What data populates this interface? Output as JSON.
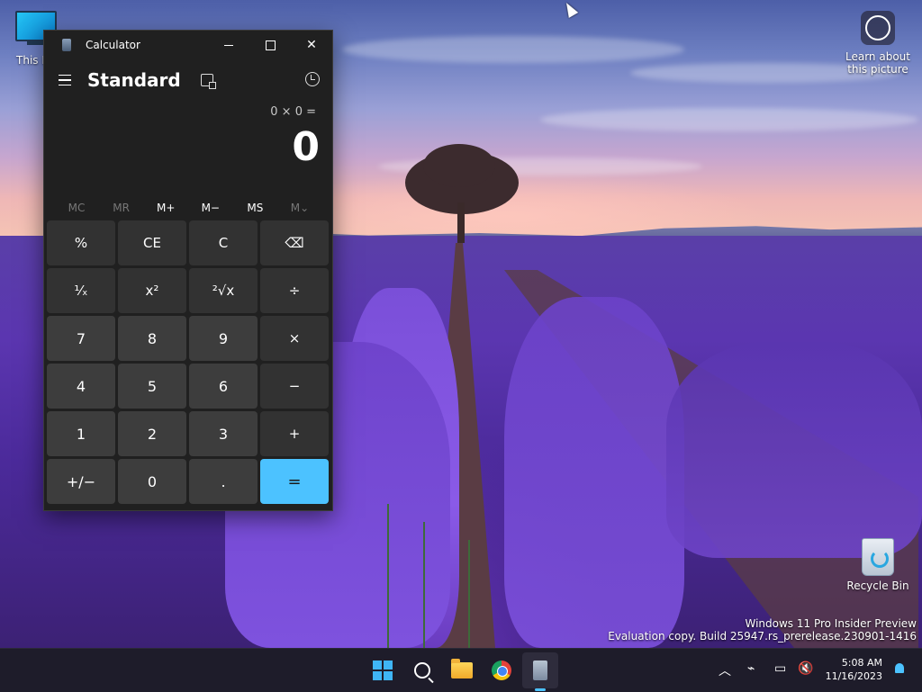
{
  "desktop": {
    "icons": [
      {
        "label": "This PC"
      },
      {
        "label": "Learn about this picture"
      },
      {
        "label": "Recycle Bin"
      }
    ],
    "watermark": {
      "line1": "Windows 11 Pro Insider Preview",
      "line2": "Evaluation copy. Build 25947.rs_prerelease.230901-1416"
    }
  },
  "calculator": {
    "window_title": "Calculator",
    "mode": "Standard",
    "expression": "0 × 0 =",
    "display": "0",
    "memory": [
      {
        "label": "MC",
        "enabled": false
      },
      {
        "label": "MR",
        "enabled": false
      },
      {
        "label": "M+",
        "enabled": true
      },
      {
        "label": "M−",
        "enabled": true
      },
      {
        "label": "MS",
        "enabled": true
      },
      {
        "label": "M⌄",
        "enabled": false
      }
    ],
    "keys": [
      {
        "label": "%",
        "kind": "fn",
        "name": "percent-button"
      },
      {
        "label": "CE",
        "kind": "fn",
        "name": "clear-entry-button"
      },
      {
        "label": "C",
        "kind": "fn",
        "name": "clear-button"
      },
      {
        "label": "⌫",
        "kind": "fn",
        "name": "backspace-button"
      },
      {
        "label": "¹⁄ₓ",
        "kind": "fn",
        "name": "reciprocal-button"
      },
      {
        "label": "x²",
        "kind": "fn",
        "name": "square-button"
      },
      {
        "label": "²√x",
        "kind": "fn",
        "name": "square-root-button"
      },
      {
        "label": "÷",
        "kind": "fn",
        "name": "divide-button"
      },
      {
        "label": "7",
        "kind": "num",
        "name": "digit-7-button"
      },
      {
        "label": "8",
        "kind": "num",
        "name": "digit-8-button"
      },
      {
        "label": "9",
        "kind": "num",
        "name": "digit-9-button"
      },
      {
        "label": "×",
        "kind": "fn",
        "name": "multiply-button"
      },
      {
        "label": "4",
        "kind": "num",
        "name": "digit-4-button"
      },
      {
        "label": "5",
        "kind": "num",
        "name": "digit-5-button"
      },
      {
        "label": "6",
        "kind": "num",
        "name": "digit-6-button"
      },
      {
        "label": "−",
        "kind": "fn",
        "name": "subtract-button"
      },
      {
        "label": "1",
        "kind": "num",
        "name": "digit-1-button"
      },
      {
        "label": "2",
        "kind": "num",
        "name": "digit-2-button"
      },
      {
        "label": "3",
        "kind": "num",
        "name": "digit-3-button"
      },
      {
        "label": "+",
        "kind": "fn",
        "name": "add-button"
      },
      {
        "label": "+/−",
        "kind": "num",
        "name": "negate-button"
      },
      {
        "label": "0",
        "kind": "num",
        "name": "digit-0-button"
      },
      {
        "label": ".",
        "kind": "num",
        "name": "decimal-button"
      },
      {
        "label": "=",
        "kind": "eq",
        "name": "equals-button"
      }
    ]
  },
  "taskbar": {
    "time": "5:08 AM",
    "date": "11/16/2023",
    "apps": [
      "start-icon",
      "search-icon",
      "file-explorer-icon",
      "chrome-icon",
      "calculator-icon"
    ],
    "tray_icons": [
      "chevron-up-icon",
      "network-icon",
      "display-icon",
      "volume-muted-icon",
      "notification-bell-icon"
    ]
  },
  "colors": {
    "accent": "#4cc2ff",
    "window_bg": "#202020",
    "key_bg": "#3b3b3b",
    "taskbar_bg": "#1e1c2a"
  }
}
